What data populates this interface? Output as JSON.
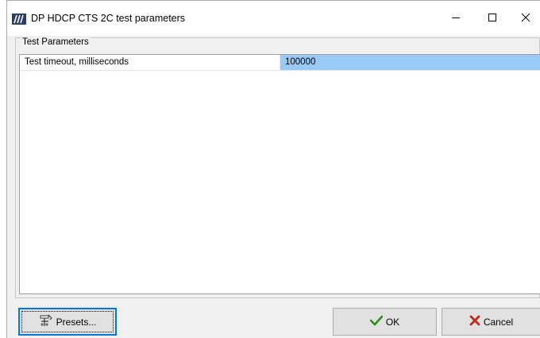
{
  "window": {
    "title": "DP HDCP CTS 2C test parameters"
  },
  "group": {
    "label": "Test Parameters"
  },
  "parameters": [
    {
      "name": "Test timeout, milliseconds",
      "value": "100000"
    }
  ],
  "buttons": {
    "presets": "Presets...",
    "ok": "OK",
    "cancel": "Cancel"
  },
  "colors": {
    "selection": "#99c9f5",
    "focus_border": "#0078d7",
    "ok_check": "#2e8b1e",
    "cancel_x": "#c0281c"
  },
  "icons": {
    "app": "app-logo-icon",
    "minimize": "minimize-icon",
    "maximize": "maximize-icon",
    "close": "close-icon",
    "presets": "presets-icon",
    "ok": "checkmark-icon",
    "cancel": "x-icon"
  }
}
